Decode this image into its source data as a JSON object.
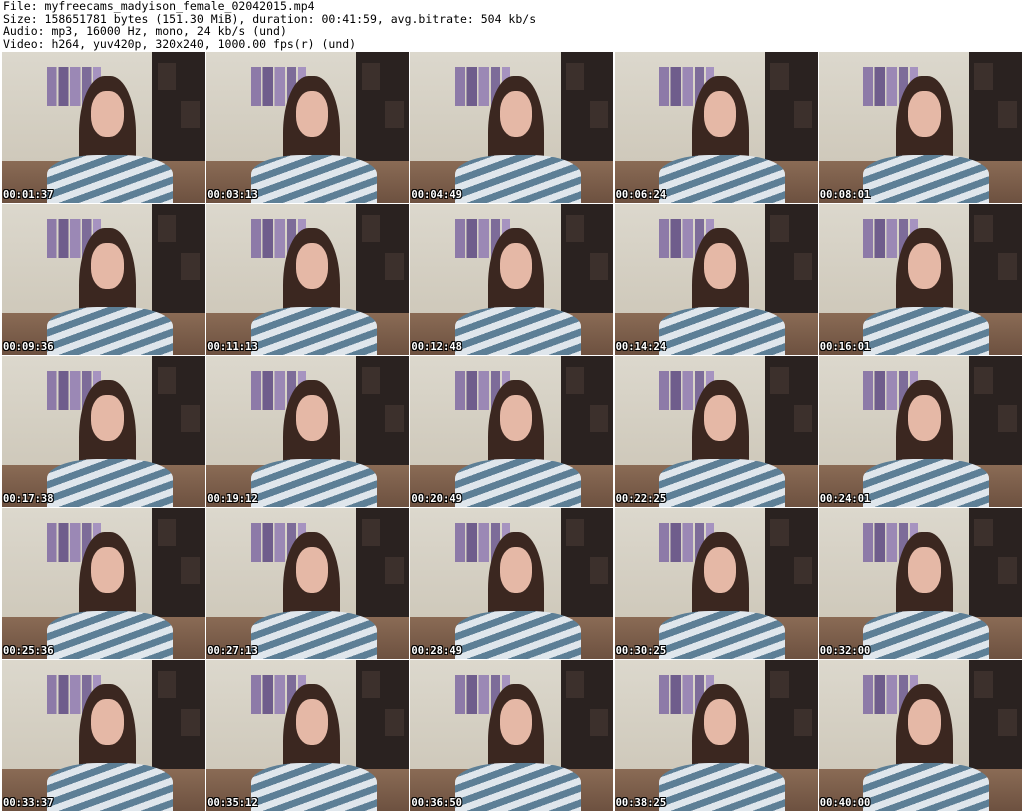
{
  "header": {
    "file_line": "File: myfreecams_madyison_female_02042015.mp4",
    "size_line": "Size: 158651781 bytes (151.30 MiB), duration: 00:41:59, avg.bitrate: 504 kb/s",
    "audio_line": "Audio: mp3, 16000 Hz, mono, 24 kb/s (und)",
    "video_line": "Video: h264, yuv420p, 320x240, 1000.00 fps(r) (und)"
  },
  "thumbnails": [
    {
      "timestamp": "00:01:37"
    },
    {
      "timestamp": "00:03:13"
    },
    {
      "timestamp": "00:04:49"
    },
    {
      "timestamp": "00:06:24"
    },
    {
      "timestamp": "00:08:01"
    },
    {
      "timestamp": "00:09:36"
    },
    {
      "timestamp": "00:11:13"
    },
    {
      "timestamp": "00:12:48"
    },
    {
      "timestamp": "00:14:24"
    },
    {
      "timestamp": "00:16:01"
    },
    {
      "timestamp": "00:17:38"
    },
    {
      "timestamp": "00:19:12"
    },
    {
      "timestamp": "00:20:49"
    },
    {
      "timestamp": "00:22:25"
    },
    {
      "timestamp": "00:24:01"
    },
    {
      "timestamp": "00:25:36"
    },
    {
      "timestamp": "00:27:13"
    },
    {
      "timestamp": "00:28:49"
    },
    {
      "timestamp": "00:30:25"
    },
    {
      "timestamp": "00:32:00"
    },
    {
      "timestamp": "00:33:37"
    },
    {
      "timestamp": "00:35:12"
    },
    {
      "timestamp": "00:36:50"
    },
    {
      "timestamp": "00:38:25"
    },
    {
      "timestamp": "00:40:00"
    }
  ]
}
